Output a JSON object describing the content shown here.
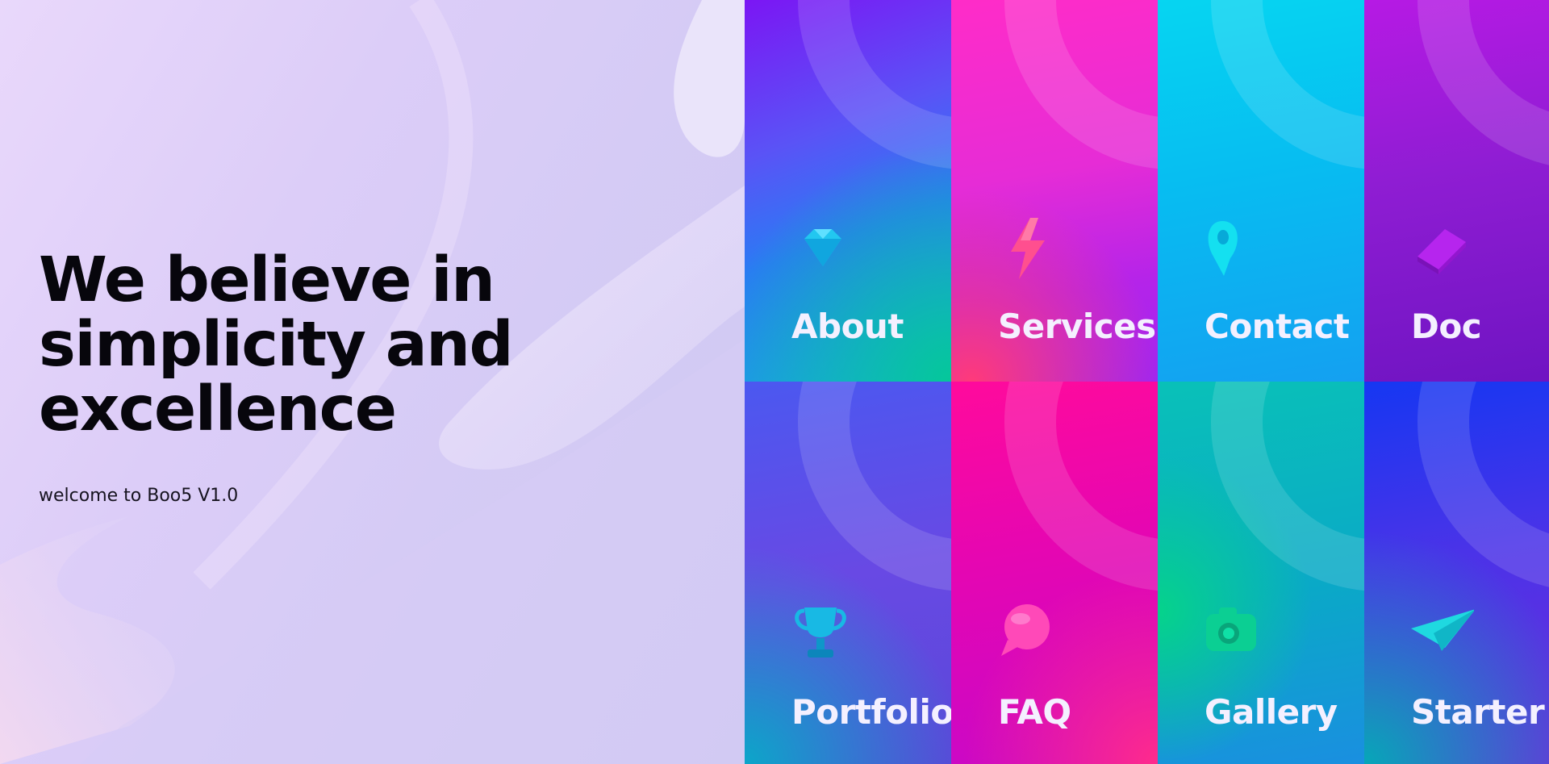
{
  "hero": {
    "title": "We believe in simplicity and excellence",
    "subtitle": "welcome to Boo5 V1.0"
  },
  "tiles": [
    {
      "label": "About",
      "icon": "diamond-icon"
    },
    {
      "label": "Services",
      "icon": "lightning-icon"
    },
    {
      "label": "Contact",
      "icon": "map-pin-icon"
    },
    {
      "label": "Doc",
      "icon": "book-icon"
    },
    {
      "label": "Portfolio",
      "icon": "trophy-icon"
    },
    {
      "label": "FAQ",
      "icon": "chat-bubble-icon"
    },
    {
      "label": "Gallery",
      "icon": "camera-icon"
    },
    {
      "label": "Starter",
      "icon": "paper-plane-icon"
    }
  ]
}
